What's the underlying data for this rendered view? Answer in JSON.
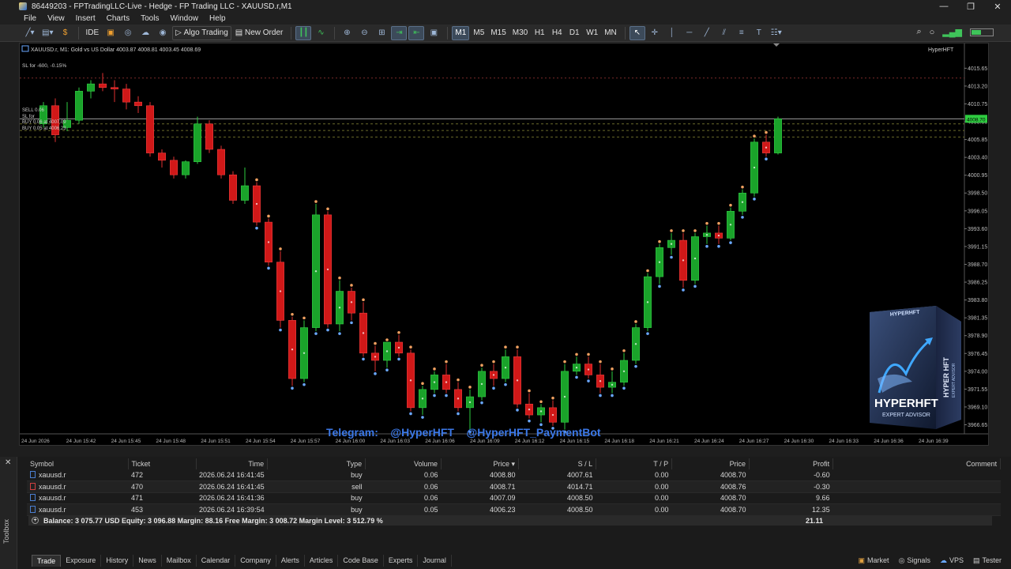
{
  "window": {
    "title": "86449203 - FPTradingLLC-Live - Hedge - FP Trading LLC - XAUUSD.r,M1",
    "minimize": "—",
    "maximize": "❐",
    "close": "✕"
  },
  "menu": [
    "File",
    "View",
    "Insert",
    "Charts",
    "Tools",
    "Window",
    "Help"
  ],
  "toolbar": {
    "ide": "IDE",
    "algo_trading": "Algo Trading",
    "new_order": "New Order",
    "timeframes": [
      "M1",
      "M5",
      "M15",
      "M30",
      "H1",
      "H4",
      "D1",
      "W1",
      "MN"
    ],
    "active_timeframe": "M1"
  },
  "chart": {
    "header": "XAUUSD.r, M1:  Gold vs US Dollar  4003.87 4008.81 4003.45 4008.69",
    "indicator_label": "HyperHFT",
    "overlay_lines": [
      "SL for -600, -0.15%",
      "BUY 0.06 at 4007.09",
      "BUY 0.05 at 4006.23"
    ],
    "overlay_short": [
      "SELL 0.06",
      "SL for"
    ],
    "current_price_label": "4008.70",
    "telegram_text": "Telegram:    @HyperHFT    @HyperHFT_PaymentBot",
    "product_box": {
      "brand_top": "HYPERHFT",
      "side_text": "HYPER HFT",
      "side_sub": "EXPERT ADVISOR",
      "front_title": "HYPERHFT",
      "front_sub": "EXPERT ADVISOR"
    },
    "colors": {
      "bull": "#1aa32a",
      "bear": "#d01818",
      "background": "#000000",
      "price_tag": "#2ecc40"
    }
  },
  "chart_data": {
    "type": "candlestick",
    "y_ticks": [
      "4015.65",
      "4013.20",
      "4010.75",
      "4008.30",
      "4005.85",
      "4003.40",
      "4000.95",
      "3998.50",
      "3996.05",
      "3993.60",
      "3991.15",
      "3988.70",
      "3986.25",
      "3983.80",
      "3981.35",
      "3978.90",
      "3976.45",
      "3974.00",
      "3971.55",
      "3969.10",
      "3966.65"
    ],
    "ylim": [
      3965.4,
      4017.1
    ],
    "x_ticks": [
      "24 Jun 2026",
      "24 Jun 15:42",
      "24 Jun 15:45",
      "24 Jun 15:48",
      "24 Jun 15:51",
      "24 Jun 15:54",
      "24 Jun 15:57",
      "24 Jun 16:00",
      "24 Jun 16:03",
      "24 Jun 16:06",
      "24 Jun 16:09",
      "24 Jun 16:12",
      "24 Jun 16:15",
      "24 Jun 16:18",
      "24 Jun 16:21",
      "24 Jun 16:24",
      "24 Jun 16:27",
      "24 Jun 16:30",
      "24 Jun 16:33",
      "24 Jun 16:36",
      "24 Jun 16:39"
    ],
    "levels": [
      4008.7,
      4008.0,
      4007.1,
      4006.2
    ],
    "candles": [
      [
        4008.0,
        4011.0,
        4007.5,
        4010.5
      ],
      [
        4010.5,
        4011.5,
        4005.5,
        4006.5
      ],
      [
        4007.5,
        4011.0,
        4007.0,
        4008.5
      ],
      [
        4008.5,
        4013.0,
        4008.0,
        4012.5
      ],
      [
        4012.5,
        4014.0,
        4011.5,
        4013.5
      ],
      [
        4013.5,
        4015.0,
        4012.5,
        4013.0
      ],
      [
        4013.0,
        4014.0,
        4011.0,
        4012.8
      ],
      [
        4012.8,
        4013.5,
        4010.0,
        4011.0
      ],
      [
        4011.0,
        4011.8,
        4009.5,
        4010.5
      ],
      [
        4010.5,
        4011.0,
        4003.5,
        4004.0
      ],
      [
        4004.0,
        4004.5,
        4002.0,
        4003.0
      ],
      [
        4003.0,
        4003.5,
        4000.5,
        4001.0
      ],
      [
        4001.0,
        4003.0,
        4000.5,
        4002.8
      ],
      [
        4002.8,
        4009.0,
        4002.5,
        4008.0
      ],
      [
        4008.0,
        4008.5,
        4004.0,
        4004.5
      ],
      [
        4004.5,
        4005.0,
        4000.5,
        4001.0
      ],
      [
        4001.0,
        4001.5,
        3997.0,
        3997.5
      ],
      [
        3997.5,
        4002.0,
        3997.0,
        3999.5
      ],
      [
        3999.5,
        4000.0,
        3994.0,
        3994.5
      ],
      [
        3994.5,
        3995.0,
        3988.5,
        3989.0
      ],
      [
        3989.0,
        3990.5,
        3980.0,
        3981.0
      ],
      [
        3981.0,
        3981.5,
        3972.0,
        3973.0
      ],
      [
        3973.0,
        3981.0,
        3972.5,
        3980.0
      ],
      [
        3980.0,
        3997.0,
        3979.5,
        3995.5
      ],
      [
        3995.5,
        3996.0,
        3980.0,
        3980.5
      ],
      [
        3980.5,
        3986.5,
        3979.5,
        3985.0
      ],
      [
        3985.0,
        3985.5,
        3981.0,
        3982.0
      ],
      [
        3982.0,
        3983.5,
        3976.0,
        3976.5
      ],
      [
        3976.5,
        3977.5,
        3974.0,
        3975.5
      ],
      [
        3975.5,
        3978.0,
        3974.5,
        3978.0
      ],
      [
        3978.0,
        3979.0,
        3976.0,
        3976.5
      ],
      [
        3976.5,
        3977.0,
        3968.5,
        3969.0
      ],
      [
        3969.0,
        3972.0,
        3968.0,
        3971.5
      ],
      [
        3971.5,
        3974.0,
        3971.0,
        3973.5
      ],
      [
        3973.5,
        3975.0,
        3971.0,
        3971.5
      ],
      [
        3971.5,
        3972.5,
        3968.5,
        3969.0
      ],
      [
        3969.0,
        3971.5,
        3966.0,
        3970.5
      ],
      [
        3970.5,
        3974.5,
        3970.0,
        3974.0
      ],
      [
        3974.0,
        3975.0,
        3972.0,
        3973.0
      ],
      [
        3973.0,
        3977.0,
        3972.5,
        3976.0
      ],
      [
        3976.0,
        3977.0,
        3969.0,
        3969.5
      ],
      [
        3969.5,
        3971.0,
        3967.5,
        3968.0
      ],
      [
        3968.0,
        3969.5,
        3967.0,
        3969.0
      ],
      [
        3969.0,
        3970.0,
        3966.5,
        3967.0
      ],
      [
        3967.0,
        3975.0,
        3966.0,
        3974.0
      ],
      [
        3974.0,
        3976.0,
        3973.5,
        3975.0
      ],
      [
        3975.0,
        3976.0,
        3973.0,
        3973.5
      ],
      [
        3973.5,
        3975.0,
        3971.0,
        3971.8
      ],
      [
        3971.8,
        3974.0,
        3971.0,
        3972.5
      ],
      [
        3972.5,
        3976.5,
        3972.0,
        3975.5
      ],
      [
        3975.5,
        3980.5,
        3975.0,
        3980.0
      ],
      [
        3980.0,
        3987.5,
        3979.5,
        3987.0
      ],
      [
        3987.0,
        3991.5,
        3986.0,
        3991.0
      ],
      [
        3991.0,
        3993.0,
        3990.0,
        3992.0
      ],
      [
        3992.0,
        3993.0,
        3985.5,
        3986.5
      ],
      [
        3986.5,
        3993.0,
        3986.0,
        3992.5
      ],
      [
        3992.5,
        3994.0,
        3991.5,
        3993.0
      ],
      [
        3993.0,
        3994.0,
        3991.5,
        3992.3
      ],
      [
        3992.3,
        3996.5,
        3992.0,
        3996.0
      ],
      [
        3996.0,
        3999.0,
        3995.5,
        3998.5
      ],
      [
        3998.5,
        4006.0,
        3998.0,
        4005.5
      ],
      [
        4005.5,
        4006.5,
        4003.5,
        4004.0
      ],
      [
        4004.0,
        4009.0,
        4003.8,
        4008.7
      ]
    ]
  },
  "terminal": {
    "toolbox_label": "Toolbox",
    "columns": [
      "Symbol",
      "Ticket",
      "Time",
      "Type",
      "Volume",
      "Price",
      "S / L",
      "T / P",
      "Price",
      "Profit",
      "Comment"
    ],
    "rows": [
      {
        "symbol": "xauusd.r",
        "ticket": "472",
        "time": "2026.06.24 16:41:45",
        "type": "buy",
        "volume": "0.06",
        "price": "4008.80",
        "sl": "4007.61",
        "tp": "0.00",
        "cur": "4008.70",
        "profit": "-0.60"
      },
      {
        "symbol": "xauusd.r",
        "ticket": "470",
        "time": "2026.06.24 16:41:45",
        "type": "sell",
        "volume": "0.06",
        "price": "4008.71",
        "sl": "4014.71",
        "tp": "0.00",
        "cur": "4008.76",
        "profit": "-0.30"
      },
      {
        "symbol": "xauusd.r",
        "ticket": "471",
        "time": "2026.06.24 16:41:36",
        "type": "buy",
        "volume": "0.06",
        "price": "4007.09",
        "sl": "4008.50",
        "tp": "0.00",
        "cur": "4008.70",
        "profit": "9.66"
      },
      {
        "symbol": "xauusd.r",
        "ticket": "453",
        "time": "2026.06.24 16:39:54",
        "type": "buy",
        "volume": "0.05",
        "price": "4006.23",
        "sl": "4008.50",
        "tp": "0.00",
        "cur": "4008.70",
        "profit": "12.35"
      }
    ],
    "balance_text": "Balance: 3 075.77 USD   Equity: 3 096.88   Margin: 88.16   Free Margin: 3 008.72   Margin Level: 3 512.79 %",
    "total_profit": "21.11",
    "tabs": [
      "Trade",
      "Exposure",
      "History",
      "News",
      "Mailbox",
      "Calendar",
      "Company",
      "Alerts",
      "Articles",
      "Code Base",
      "Experts",
      "Journal"
    ],
    "active_tab": "Trade",
    "status_right": [
      "Market",
      "Signals",
      "VPS",
      "Tester"
    ]
  }
}
